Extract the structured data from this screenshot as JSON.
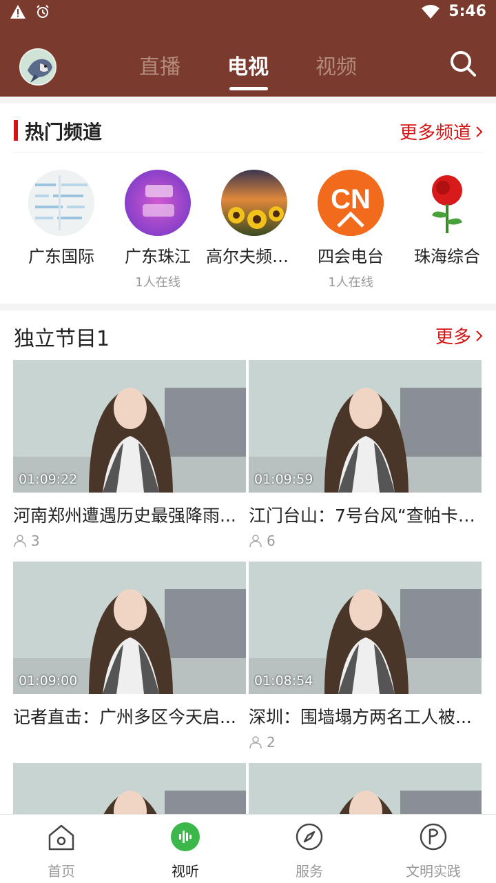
{
  "status_bar": {
    "time": "5:46"
  },
  "header": {
    "tabs": [
      {
        "label": "直播",
        "active": false
      },
      {
        "label": "电视",
        "active": true
      },
      {
        "label": "视频",
        "active": false
      }
    ]
  },
  "hot_channels": {
    "title": "热门频道",
    "more_label": "更多频道",
    "channels": [
      {
        "name": "广东国际",
        "online": ""
      },
      {
        "name": "广东珠江",
        "online": "1人在线"
      },
      {
        "name": "高尔夫频道...",
        "online": ""
      },
      {
        "name": "四会电台",
        "online": "1人在线"
      },
      {
        "name": "珠海综合",
        "online": ""
      }
    ],
    "logo_text": "CN"
  },
  "program_section": {
    "title": "独立节目1",
    "more_label": "更多",
    "videos": [
      {
        "duration": "01:09:22",
        "title": "河南郑州遭遇历史最强降雨...",
        "viewers": "3"
      },
      {
        "duration": "01:09:59",
        "title": "江门台山：7号台风“查帕卡”...",
        "viewers": "6"
      },
      {
        "duration": "01:09:00",
        "title": "记者直击：广州多区今天启...",
        "viewers": ""
      },
      {
        "duration": "01:08:54",
        "title": "深圳：围墙塌方两名工人被...",
        "viewers": "2"
      },
      {
        "duration": "",
        "title": "",
        "viewers": ""
      },
      {
        "duration": "",
        "title": "",
        "viewers": ""
      }
    ]
  },
  "bottom_nav": {
    "items": [
      {
        "label": "首页",
        "icon": "home-icon",
        "active": false
      },
      {
        "label": "视听",
        "icon": "audio-icon",
        "active": true
      },
      {
        "label": "服务",
        "icon": "compass-icon",
        "active": false
      },
      {
        "label": "文明实践",
        "icon": "flag-icon",
        "active": false
      }
    ]
  },
  "colors": {
    "header": "#7a3b2e",
    "accent": "#d41414",
    "active_green": "#3cb84a"
  }
}
